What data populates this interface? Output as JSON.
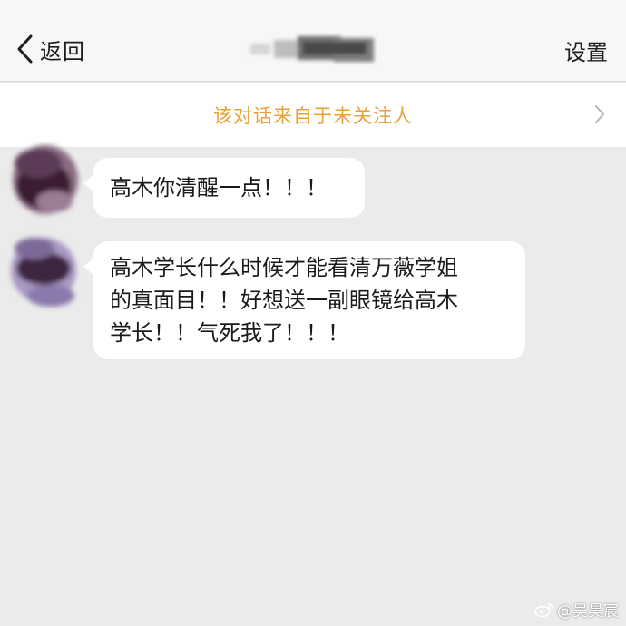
{
  "nav": {
    "back_label": "返回",
    "title": "",
    "settings_label": "设置"
  },
  "notice": {
    "text": "该对话来自于未关注人"
  },
  "messages": [
    {
      "text": "高木你清醒一点！！！"
    },
    {
      "lines": [
        "高木学长什么时候才能看清万薇学姐",
        "的真面目！！好想送一副眼镜给高木",
        "学长！！气死我了！！！"
      ]
    }
  ],
  "watermark": {
    "text": "@吴昊宸"
  },
  "colors": {
    "notice_text": "#e8a23a",
    "page_background": "#ebebeb",
    "bubble": "#ffffff"
  },
  "icons": [
    "chevron-left-icon",
    "chevron-right-icon",
    "weibo-icon"
  ]
}
